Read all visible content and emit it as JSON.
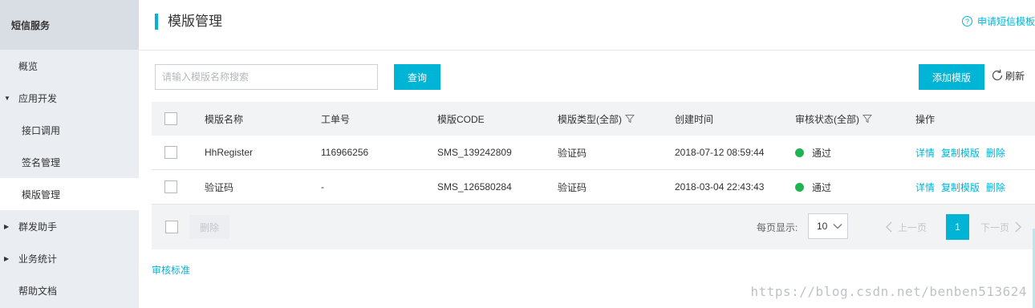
{
  "sidebar": {
    "header": "短信服务",
    "items": [
      {
        "label": "概览"
      },
      {
        "label": "应用开发"
      },
      {
        "label": "接口调用"
      },
      {
        "label": "签名管理"
      },
      {
        "label": "模版管理"
      },
      {
        "label": "群发助手"
      },
      {
        "label": "业务统计"
      },
      {
        "label": "帮助文档"
      }
    ]
  },
  "header": {
    "title": "模版管理",
    "apply_link": "申请短信模板"
  },
  "toolbar": {
    "search_placeholder": "请输入模版名称搜索",
    "search_button": "查询",
    "add_button": "添加模版",
    "refresh": "刷新"
  },
  "table": {
    "columns": [
      "模版名称",
      "工单号",
      "模版CODE",
      "模版类型(全部)",
      "创建时间",
      "审核状态(全部)",
      "操作"
    ],
    "rows": [
      {
        "name": "HhRegister",
        "ticket": "116966256",
        "code": "SMS_139242809",
        "type": "验证码",
        "created": "2018-07-12 08:59:44",
        "status": "通过",
        "ops": [
          "详情",
          "复制模版",
          "删除"
        ]
      },
      {
        "name": "验证码",
        "ticket": "-",
        "code": "SMS_126580284",
        "type": "验证码",
        "created": "2018-03-04 22:43:43",
        "status": "通过",
        "ops": [
          "详情",
          "复制模版",
          "删除"
        ]
      }
    ]
  },
  "footer": {
    "delete_button": "删除",
    "per_page_label": "每页显示:",
    "per_page_value": "10",
    "prev": "上一页",
    "current_page": "1",
    "next": "下一页"
  },
  "review_link": "审核标准",
  "watermark": "https://blog.csdn.net/benben513624",
  "colors": {
    "accent": "#00b4d6",
    "status_pass": "#1fb451",
    "sidebar_bg": "#eaedf1"
  }
}
